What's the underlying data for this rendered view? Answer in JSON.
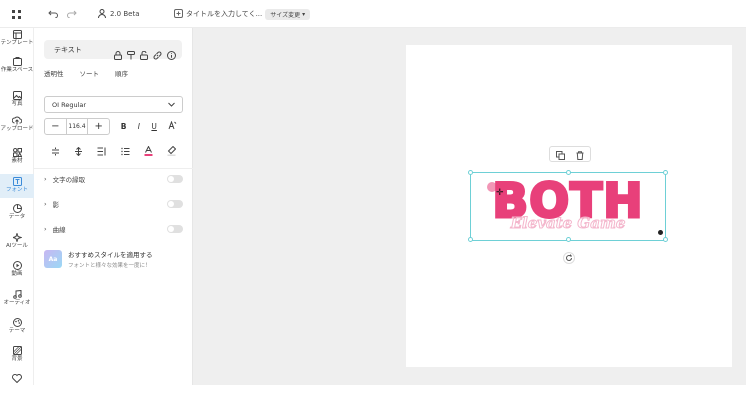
{
  "topbar": {
    "version": "2.0 Beta",
    "title_placeholder": "タイトルを入力してく...",
    "size_label": "サイズ変更"
  },
  "sidebar": {
    "items": [
      {
        "label": "テンプレート",
        "icon": "template-icon"
      },
      {
        "label": "作業スペース",
        "icon": "workspace-icon"
      },
      {
        "label": "写真",
        "icon": "photo-icon"
      },
      {
        "label": "アップロード",
        "icon": "upload-icon"
      },
      {
        "label": "素材",
        "icon": "elements-icon"
      },
      {
        "label": "フォント",
        "icon": "font-icon"
      },
      {
        "label": "データ",
        "icon": "data-icon"
      },
      {
        "label": "AIツール",
        "icon": "ai-tools-icon"
      },
      {
        "label": "動画",
        "icon": "video-icon"
      },
      {
        "label": "オーディオ",
        "icon": "audio-icon"
      },
      {
        "label": "テーマ",
        "icon": "theme-icon"
      },
      {
        "label": "背景",
        "icon": "background-icon"
      }
    ],
    "active_index": 5
  },
  "panel": {
    "tab_label": "テキスト",
    "subtabs": [
      "透明性",
      "ソート",
      "順序"
    ],
    "font_name": "OI Regular",
    "font_size": "116.4",
    "style_buttons": [
      "B",
      "I",
      "U"
    ],
    "accordion": [
      {
        "label": "文字の縁取"
      },
      {
        "label": "影"
      },
      {
        "label": "曲線"
      }
    ],
    "promo_title": "おすすめスタイルを適用する",
    "promo_subtitle": "フォントと様々な効果を一度に！"
  },
  "canvas": {
    "main_text": "BOTH",
    "sub_text": "Elevate Game",
    "main_color": "#e8407a",
    "sub_color": "#f4b6cc",
    "selection_color": "#6ed0d6"
  },
  "colors": {
    "accent": "#3b8bd9",
    "text_color_indicator": "#e8407a"
  }
}
